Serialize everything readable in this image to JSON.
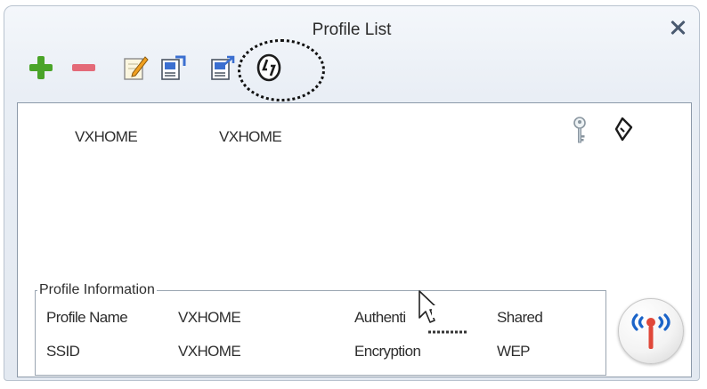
{
  "window": {
    "title": "Profile List"
  },
  "toolbar": {
    "buttons": [
      {
        "name": "add",
        "icon": "plus-icon"
      },
      {
        "name": "remove",
        "icon": "minus-icon"
      },
      {
        "name": "edit",
        "icon": "edit-icon"
      },
      {
        "name": "duplicate",
        "icon": "duplicate-icon"
      },
      {
        "name": "set-default",
        "icon": "set-default-icon"
      },
      {
        "name": "refresh",
        "icon": "refresh-icon"
      }
    ]
  },
  "profiles": [
    {
      "profile_name": "VXHOME",
      "ssid": "VXHOME",
      "icons": [
        "key-icon",
        "active-profile-icon"
      ]
    }
  ],
  "profile_info": {
    "legend": "Profile Information",
    "profile_name_label": "Profile Name",
    "profile_name_value": "VXHOME",
    "ssid_label": "SSID",
    "ssid_value": "VXHOME",
    "authentication_label": "Authenti",
    "authentication_value": "Shared",
    "encryption_label": "Encryption",
    "encryption_value": "WEP"
  },
  "colors": {
    "add_green": "#4aa428",
    "remove_pink": "#e46a78",
    "signal_blue": "#1a63c8",
    "signal_red": "#e0483a"
  }
}
